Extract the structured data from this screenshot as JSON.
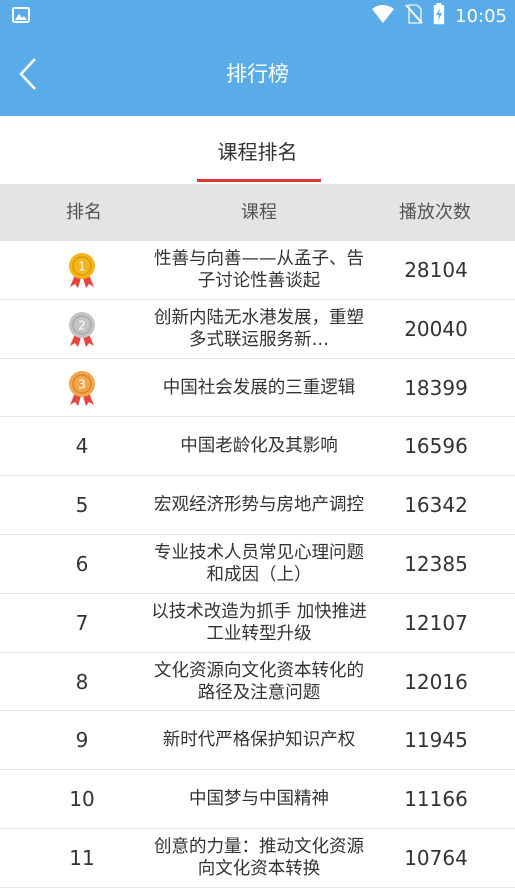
{
  "status_bar": {
    "time": "10:05",
    "icons": [
      "image-icon",
      "wifi-icon",
      "no-sim-icon",
      "battery-charging-icon"
    ]
  },
  "header": {
    "title": "排行榜",
    "back_icon": "chevron-left-icon"
  },
  "tabs": [
    {
      "label": "课程排名",
      "active": true
    }
  ],
  "table": {
    "columns": [
      "排名",
      "课程",
      "播放次数"
    ],
    "rows": [
      {
        "rank": "1",
        "medal": "gold",
        "course": "性善与向善——从孟子、告子讨论性善谈起",
        "plays": "28104"
      },
      {
        "rank": "2",
        "medal": "silver",
        "course": "创新内陆无水港发展，重塑多式联运服务新…",
        "plays": "20040"
      },
      {
        "rank": "3",
        "medal": "bronze",
        "course": "中国社会发展的三重逻辑",
        "plays": "18399"
      },
      {
        "rank": "4",
        "medal": "",
        "course": "中国老龄化及其影响",
        "plays": "16596"
      },
      {
        "rank": "5",
        "medal": "",
        "course": "宏观经济形势与房地产调控",
        "plays": "16342"
      },
      {
        "rank": "6",
        "medal": "",
        "course": "专业技术人员常见心理问题和成因（上）",
        "plays": "12385"
      },
      {
        "rank": "7",
        "medal": "",
        "course": "以技术改造为抓手 加快推进工业转型升级",
        "plays": "12107"
      },
      {
        "rank": "8",
        "medal": "",
        "course": "文化资源向文化资本转化的路径及注意问题",
        "plays": "12016"
      },
      {
        "rank": "9",
        "medal": "",
        "course": "新时代严格保护知识产权",
        "plays": "11945"
      },
      {
        "rank": "10",
        "medal": "",
        "course": "中国梦与中国精神",
        "plays": "11166"
      },
      {
        "rank": "11",
        "medal": "",
        "course": "创意的力量：推动文化资源向文化资本转换",
        "plays": "10764"
      }
    ]
  },
  "colors": {
    "primary": "#5aace8",
    "tab_underline": "#e0323a",
    "header_bg": "#e4e4e4",
    "gold": "#f2b51c",
    "silver": "#c4c4c4",
    "bronze": "#f0a64a",
    "ribbon": "#e8453c"
  }
}
